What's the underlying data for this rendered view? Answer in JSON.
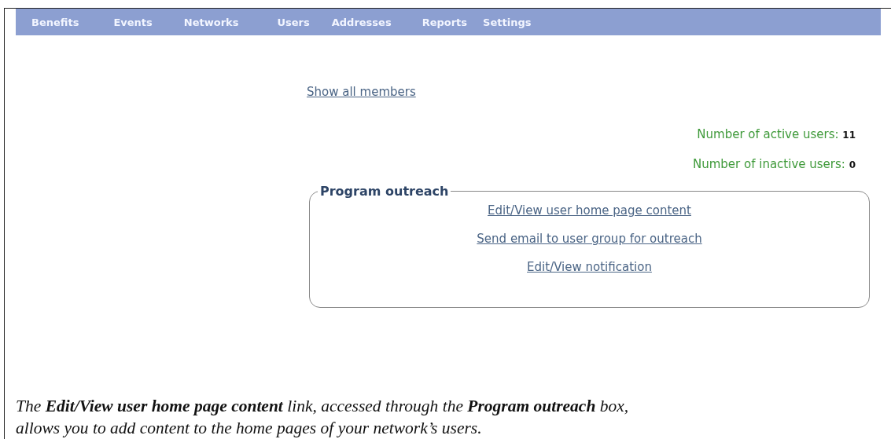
{
  "nav": [
    {
      "label": "Benefits"
    },
    {
      "label": "Events"
    },
    {
      "label": "Networks"
    },
    {
      "label": "Users"
    },
    {
      "label": "Addresses"
    },
    {
      "label": "Reports"
    },
    {
      "label": "Settings"
    }
  ],
  "show_all_link": "Show all members",
  "stats": [
    {
      "label": "Number of active users:",
      "value": "11"
    },
    {
      "label": "Number of inactive users:",
      "value": "0"
    }
  ],
  "outreach": {
    "legend": "Program outreach",
    "links": [
      "Edit/View user home page content",
      "Send email to user group for outreach",
      "Edit/View notification"
    ]
  },
  "caption": "The **Edit/View user home page content** link, accessed through the **Program outreach** box, allows you to add content to the home pages of your network’s users."
}
